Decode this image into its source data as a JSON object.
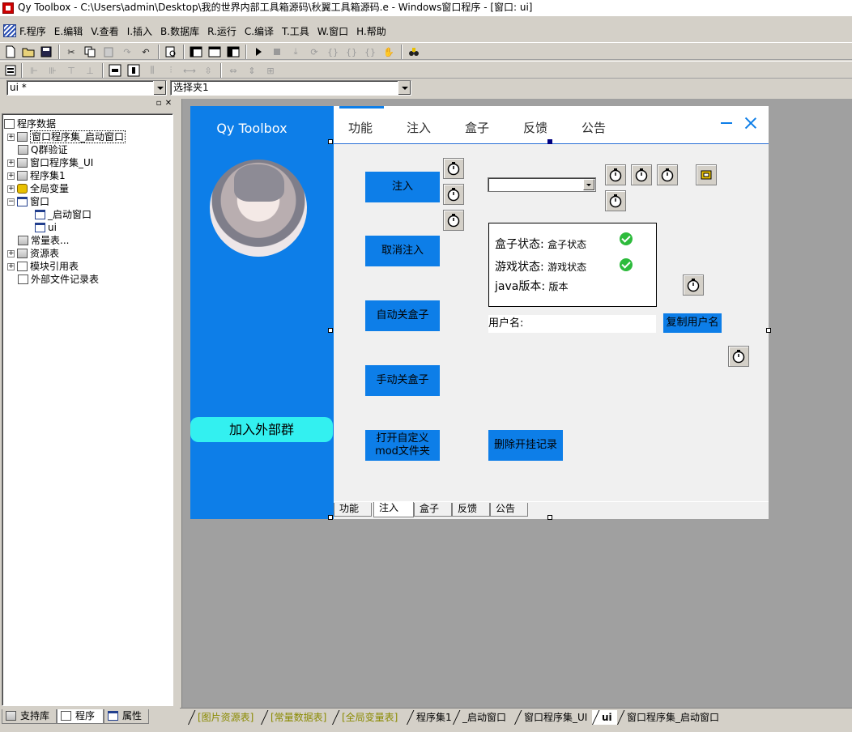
{
  "titlebar": {
    "text": "Qy Toolbox - C:\\Users\\admin\\Desktop\\我的世界内部工具箱源码\\秋翼工具箱源码.e - Windows窗口程序 - [窗口: ui]"
  },
  "menu": [
    "F.程序",
    "E.编辑",
    "V.查看",
    "I.插入",
    "B.数据库",
    "R.运行",
    "C.编译",
    "T.工具",
    "W.窗口",
    "H.帮助"
  ],
  "combos": {
    "form_name": "ui *",
    "selector": "选择夹1"
  },
  "tree": {
    "root": "程序数据",
    "items": [
      "窗口程序集_启动窗口",
      "Q群验证",
      "窗口程序集_UI",
      "程序集1",
      "全局变量",
      "窗口",
      "_启动窗口",
      "ui",
      "常量表...",
      "资源表",
      "模块引用表",
      "外部文件记录表"
    ]
  },
  "left_tabs": [
    "支持库",
    "程序",
    "属性"
  ],
  "form": {
    "app_title": "Qy Toolbox",
    "join_group": "加入外部群",
    "nav_tabs": [
      "功能",
      "注入",
      "盒子",
      "反馈",
      "公告"
    ],
    "buttons": {
      "inject": "注入",
      "cancel_inject": "取消注入",
      "auto_close_box": "自动关盒子",
      "manual_close_box": "手动关盒子",
      "open_mod_folder": "打开自定义mod文件夹",
      "delete_records": "删除开挂记录",
      "copy_username": "复制用户名"
    },
    "status": {
      "box_label": "盒子状态:",
      "box_value": "盒子状态",
      "game_label": "游戏状态:",
      "game_value": "游戏状态",
      "java_label": "java版本:",
      "java_value": "版本"
    },
    "username_label": "用户名:",
    "page_tabs": [
      "功能",
      "注入",
      "盒子",
      "反馈",
      "公告"
    ]
  },
  "bottom_tabs": [
    "[图片资源表]",
    "[常量数据表]",
    "[全局变量表]",
    "程序集1",
    "_启动窗口",
    "窗口程序集_UI",
    "ui",
    "窗口程序集_启动窗口"
  ],
  "colors": {
    "accent": "#0d7ee8",
    "cyan_button": "#33f0f0",
    "canvas": "#a0a0a0",
    "check": "#2dbb3c"
  }
}
